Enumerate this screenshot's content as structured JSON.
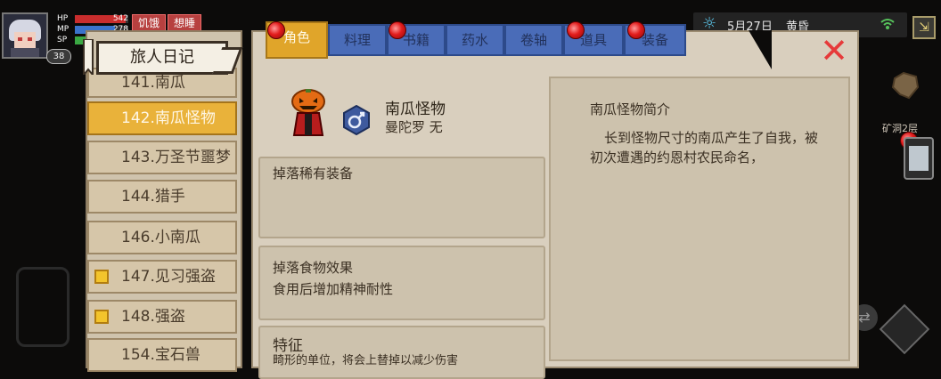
{
  "player": {
    "level": "38",
    "stats": [
      {
        "label": "HP",
        "value": "542",
        "fill": 0.95,
        "color": "#c92d2d"
      },
      {
        "label": "MP",
        "value": "278",
        "fill": 0.75,
        "color": "#3a73cc"
      },
      {
        "label": "SP",
        "value": "",
        "fill": 0.55,
        "color": "#3aa843"
      }
    ],
    "status_tags": [
      "饥饿",
      "想睡"
    ]
  },
  "hud": {
    "date": "5月27日",
    "time_of_day": "黄昏",
    "map_name": "矿洞2层"
  },
  "tabs": [
    "角色",
    "料理",
    "书籍",
    "药水",
    "卷轴",
    "道具",
    "装备"
  ],
  "active_tab": 0,
  "journal": {
    "title": "旅人日记",
    "items": [
      {
        "label": "141.南瓜",
        "selected": false,
        "coin": false
      },
      {
        "label": "142.南瓜怪物",
        "selected": true,
        "coin": false
      },
      {
        "label": "143.万圣节噩梦",
        "selected": false,
        "coin": false
      },
      {
        "label": "144.猎手",
        "selected": false,
        "coin": false
      },
      {
        "label": "146.小南瓜",
        "selected": false,
        "coin": false
      },
      {
        "label": "147.见习强盗",
        "selected": false,
        "coin": true
      },
      {
        "label": "148.强盗",
        "selected": false,
        "coin": true
      },
      {
        "label": "154.宝石兽",
        "selected": false,
        "coin": false
      }
    ]
  },
  "monster": {
    "name": "南瓜怪物",
    "subtitle": "曼陀罗 无",
    "sections": [
      {
        "heading": "掉落稀有装备",
        "body": ""
      },
      {
        "heading": "掉落食物效果",
        "body": "食用后增加精神耐性"
      },
      {
        "heading": "特征",
        "body": "畸形的单位，将会上替掉以减少伤害"
      }
    ],
    "description_title": "南瓜怪物简介",
    "description": "长到怪物尺寸的南瓜产生了自我，被初次遭遇的约恩村农民命名，"
  },
  "colors": {
    "tab_active": "#e0a52a",
    "tab_inactive": "#4a6cb8",
    "list_selected": "#e9b23a",
    "close": "#e63a3a"
  },
  "icons": [
    "sun-icon",
    "wifi-icon",
    "exit-icon",
    "close-icon",
    "phone-icon",
    "map-icon",
    "skill-icon",
    "type-badge-icon",
    "pumpkin-monster-sprite",
    "coin-icon"
  ]
}
